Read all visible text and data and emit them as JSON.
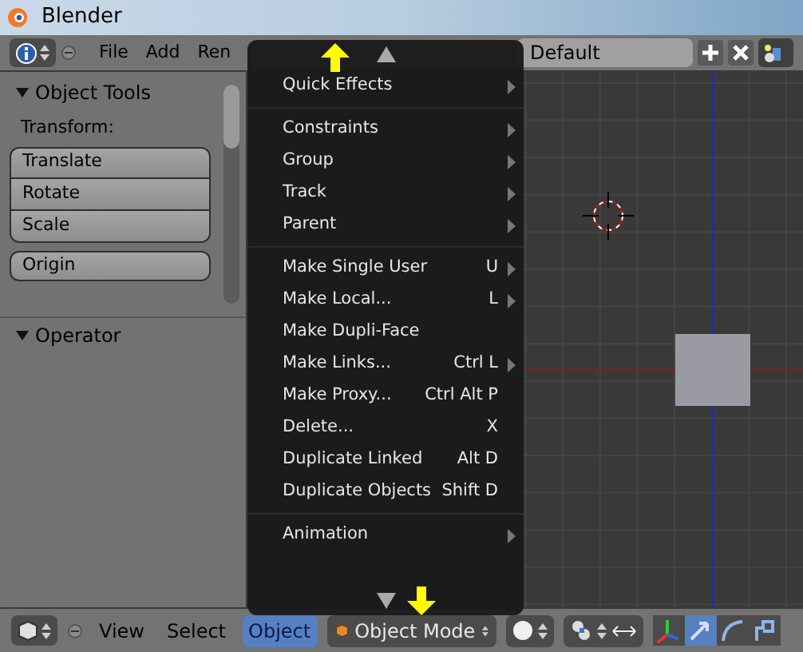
{
  "title_bar": {
    "title": "Blender"
  },
  "top_header": {
    "menus": [
      "File",
      "Add",
      "Ren"
    ],
    "layout_field": {
      "value": "Default"
    }
  },
  "tool_shelf": {
    "panels": [
      {
        "title": "Object Tools",
        "expanded": true
      },
      {
        "title": "Operator",
        "expanded": true
      }
    ],
    "transform_label": "Transform:",
    "transform_buttons": [
      "Translate",
      "Rotate",
      "Scale"
    ],
    "origin_button": "Origin"
  },
  "menu": {
    "groups": [
      [
        {
          "label": "Quick Effects",
          "submenu": true
        }
      ],
      [
        {
          "label": "Constraints",
          "submenu": true
        },
        {
          "label": "Group",
          "submenu": true
        },
        {
          "label": "Track",
          "submenu": true
        },
        {
          "label": "Parent",
          "submenu": true
        }
      ],
      [
        {
          "label": "Make Single User",
          "shortcut": "U",
          "submenu": true
        },
        {
          "label": "Make Local...",
          "shortcut": "L",
          "submenu": true
        },
        {
          "label": "Make Dupli-Face",
          "submenu": false
        },
        {
          "label": "Make Links...",
          "shortcut": "Ctrl L",
          "submenu": true
        },
        {
          "label": "Make Proxy...",
          "shortcut": "Ctrl Alt P",
          "submenu": false
        },
        {
          "label": "Delete...",
          "shortcut": "X",
          "submenu": false
        },
        {
          "label": "Duplicate Linked",
          "shortcut": "Alt D",
          "submenu": false
        },
        {
          "label": "Duplicate Objects",
          "shortcut": "Shift D",
          "submenu": false
        }
      ],
      [
        {
          "label": "Animation",
          "submenu": true
        }
      ]
    ]
  },
  "bottom_header": {
    "menus": [
      {
        "label": "View",
        "selected": false
      },
      {
        "label": "Select",
        "selected": false
      },
      {
        "label": "Object",
        "selected": true
      }
    ],
    "mode_dropdown": {
      "value": "Object Mode"
    }
  }
}
